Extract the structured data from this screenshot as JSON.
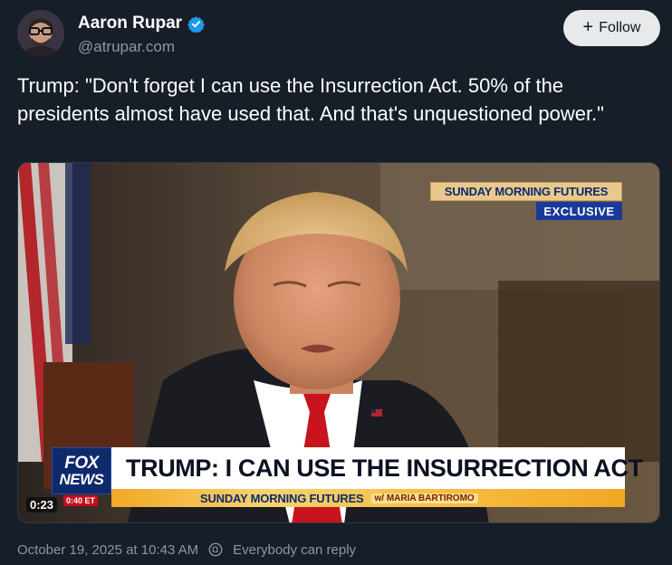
{
  "author": {
    "name": "Aaron Rupar",
    "handle": "@atrupar.com",
    "verified_color": "#1d9bf0"
  },
  "follow_button": {
    "label": "Follow"
  },
  "tweet": {
    "text": "Trump: \"Don't forget I can use the Insurrection Act. 50% of the presidents almost have used that. And that's unquestioned power.\""
  },
  "video": {
    "show_badge": "SUNDAY MORNING FUTURES",
    "exclusive_badge": "EXCLUSIVE",
    "headline": "TRUMP: I CAN USE THE INSURRECTION ACT",
    "ticker_show": "SUNDAY MORNING FUTURES",
    "ticker_host": "w/ MARIA BARTIROMO",
    "network_line1": "FOX",
    "network_line2": "NEWS",
    "broadcast_time": "0:40 ET",
    "elapsed": "0:23"
  },
  "footer": {
    "date": "October 19, 2025 at 10:43 AM",
    "reply_setting": "Everybody can reply"
  },
  "colors": {
    "background": "#161e27",
    "fox_blue": "#0e2a6b",
    "tie_red": "#c8141c"
  }
}
